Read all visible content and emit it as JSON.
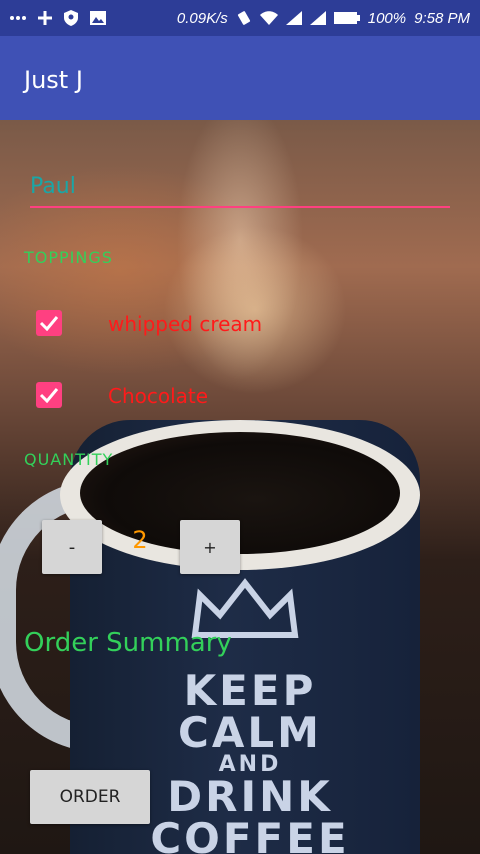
{
  "status_bar": {
    "left_icons": [
      "more-icon",
      "plus-icon",
      "shield-icon",
      "image-icon"
    ],
    "speed": "0.09K/s",
    "battery": "100%",
    "time": "9:58 PM"
  },
  "app_bar": {
    "title": "Just J"
  },
  "form": {
    "name_value": "Paul",
    "toppings_label": "TOPPINGS",
    "toppings": [
      {
        "label": "whipped cream",
        "checked": true
      },
      {
        "label": "Chocolate",
        "checked": true
      }
    ],
    "quantity_label": "QUANTITY",
    "decrement_label": "-",
    "quantity": "2",
    "increment_label": "+",
    "summary_label": "Order Summary",
    "order_label": "ORDER"
  },
  "background": {
    "mug_text": [
      "KEEP",
      "CALM",
      "AND",
      "DRINK",
      "COFFEE"
    ]
  },
  "colors": {
    "status_bar": "#2d3d97",
    "app_bar": "#3f51b5",
    "accent": "#ff4081",
    "label_green": "#33d05a",
    "topping_red": "#ff1a1a",
    "quantity_orange": "#ff9800",
    "name_teal": "#1aa6a6"
  }
}
